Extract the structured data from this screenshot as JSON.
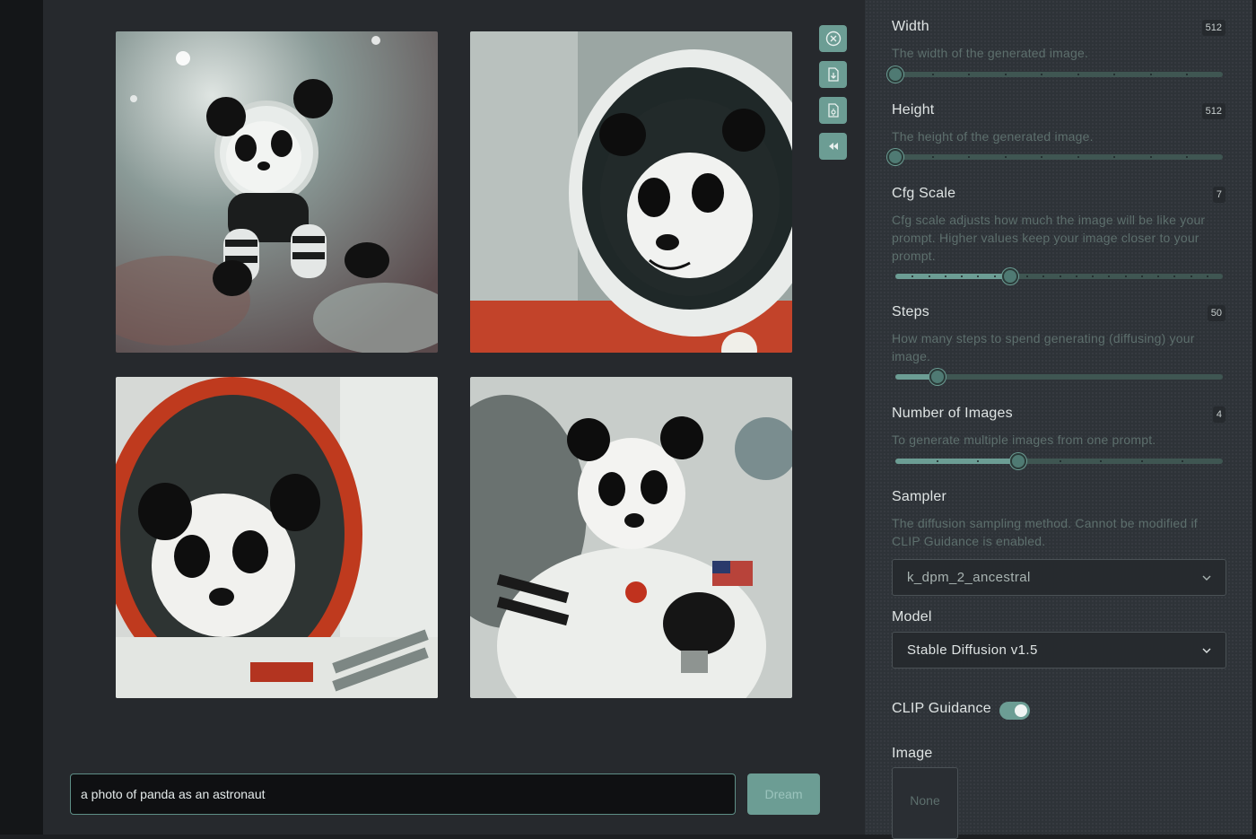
{
  "gallery": {
    "images": [
      {
        "alt": "panda plush astronaut floating in space"
      },
      {
        "alt": "panda in spacesuit helmet close-up"
      },
      {
        "alt": "panda in orange-rimmed helmet"
      },
      {
        "alt": "panda astronaut with flag patch"
      }
    ]
  },
  "toolbar": {
    "cancel_icon": "close-circle-icon",
    "download_icon": "download-file-icon",
    "upscale_icon": "file-settings-icon",
    "rewind_icon": "rewind-icon"
  },
  "prompt": {
    "value": "a photo of panda as an astronaut",
    "submit_label": "Dream"
  },
  "settings": {
    "width": {
      "label": "Width",
      "value": "512",
      "description": "The width of the generated image.",
      "fraction": 0.0
    },
    "height": {
      "label": "Height",
      "value": "512",
      "description": "The height of the generated image.",
      "fraction": 0.0
    },
    "cfg_scale": {
      "label": "Cfg Scale",
      "value": "7",
      "description": "Cfg scale adjusts how much the image will be like your prompt. Higher values keep your image closer to your prompt.",
      "fraction": 0.35
    },
    "steps": {
      "label": "Steps",
      "value": "50",
      "description": "How many steps to spend generating (diffusing) your image.",
      "fraction": 0.13
    },
    "num_images": {
      "label": "Number of Images",
      "value": "4",
      "description": "To generate multiple images from one prompt.",
      "fraction": 0.375
    },
    "sampler": {
      "label": "Sampler",
      "description": "The diffusion sampling method. Cannot be modified if CLIP Guidance is enabled.",
      "selected": "k_dpm_2_ancestral"
    },
    "model": {
      "label": "Model",
      "selected": "Stable Diffusion v1.5"
    },
    "clip_guidance": {
      "label": "CLIP Guidance",
      "enabled": true
    },
    "image": {
      "label": "Image",
      "value": "None"
    }
  },
  "colors": {
    "accent": "#6c9d94",
    "panel": "#2e3338",
    "main": "#26292d"
  }
}
